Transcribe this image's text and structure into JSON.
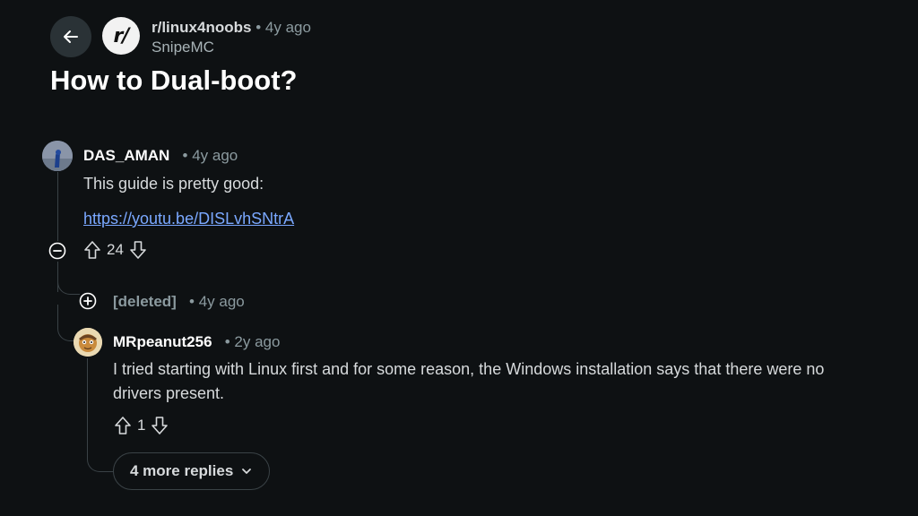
{
  "post": {
    "subreddit": "r/linux4noobs",
    "time": "4y ago",
    "author": "SnipeMC",
    "title": "How to Dual-boot?",
    "subreddit_icon_text": "r/"
  },
  "comments": [
    {
      "author": "DAS_AMAN",
      "time": "4y ago",
      "body": "This guide is pretty good:",
      "link": "https://youtu.be/DISLvhSNtrA",
      "score": "24"
    },
    {
      "author": "[deleted]",
      "time": "4y ago"
    },
    {
      "author": "MRpeanut256",
      "time": "2y ago",
      "body_line1": "I tried starting with Linux first and for some reason, the Windows installation says that there were no",
      "body_line2": "drivers present.",
      "score": "1"
    }
  ],
  "more_replies": "4 more replies",
  "colors": {
    "background": "#0e1113",
    "link": "#7aa8ff",
    "thread_line": "#3a4246"
  },
  "icons": [
    "back-arrow-icon",
    "upvote-icon",
    "downvote-icon",
    "collapse-icon",
    "expand-icon",
    "chevron-down-icon"
  ]
}
